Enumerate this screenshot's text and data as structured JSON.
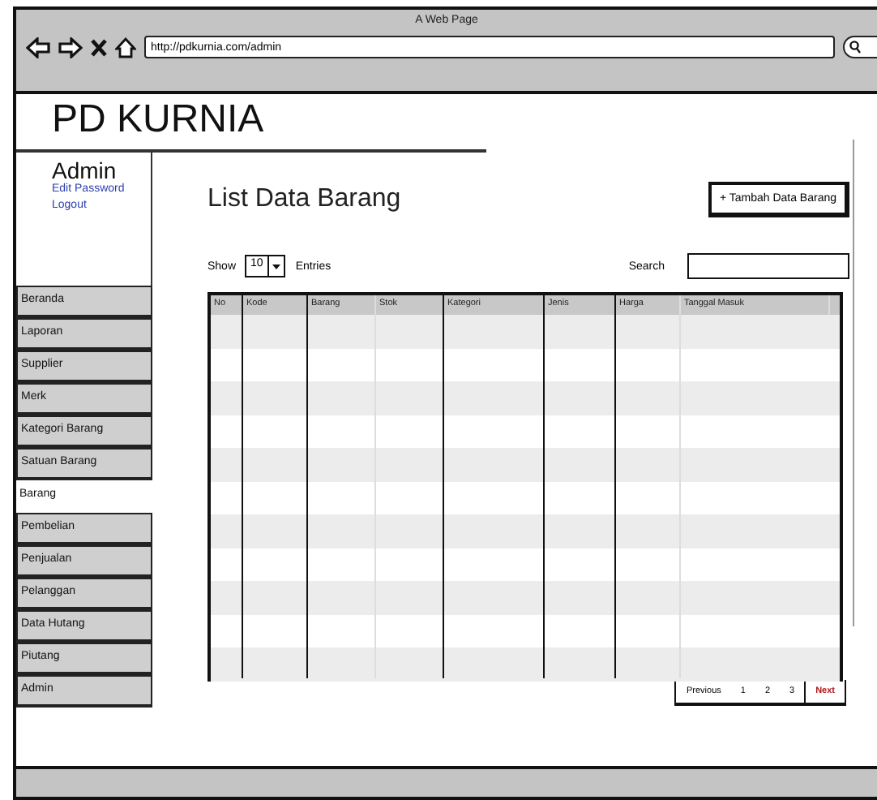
{
  "window": {
    "title": "A Web Page",
    "url": "http://pdkurnia.com/admin"
  },
  "header": {
    "title": "PD KURNIA"
  },
  "user": {
    "name": "Admin",
    "links": [
      "Edit Password",
      "Logout"
    ]
  },
  "sidebar": {
    "items": [
      {
        "label": "Beranda",
        "selected": false
      },
      {
        "label": "Laporan",
        "selected": false
      },
      {
        "label": "Supplier",
        "selected": false
      },
      {
        "label": "Merk",
        "selected": false
      },
      {
        "label": "Kategori Barang",
        "selected": false
      },
      {
        "label": "Satuan Barang",
        "selected": false
      },
      {
        "label": "Barang",
        "selected": true
      },
      {
        "label": "Pembelian",
        "selected": false
      },
      {
        "label": "Penjualan",
        "selected": false
      },
      {
        "label": "Pelanggan",
        "selected": false
      },
      {
        "label": "Data Hutang",
        "selected": false
      },
      {
        "label": "Piutang",
        "selected": false
      },
      {
        "label": "Admin",
        "selected": false
      }
    ]
  },
  "main": {
    "title": "List Data Barang",
    "add_button": "+ Tambah Data Barang",
    "show_label": "Show",
    "entries_value": "10",
    "entries_label": "Entries",
    "search_label": "Search"
  },
  "table": {
    "columns": [
      {
        "label": "No",
        "heavy": true
      },
      {
        "label": "Kode",
        "heavy": true
      },
      {
        "label": "Barang",
        "heavy": false
      },
      {
        "label": "Stok",
        "heavy": true
      },
      {
        "label": "Kategori",
        "heavy": true
      },
      {
        "label": "Jenis",
        "heavy": true
      },
      {
        "label": "Harga",
        "heavy": false
      },
      {
        "label": "Tanggal Masuk",
        "heavy": false
      }
    ]
  },
  "pagination": [
    {
      "label": "Previous",
      "kind": "plain"
    },
    {
      "label": "1",
      "kind": "plain"
    },
    {
      "label": "2",
      "kind": "plain"
    },
    {
      "label": "3",
      "kind": "plain"
    },
    {
      "label": "Next",
      "kind": "next"
    }
  ]
}
